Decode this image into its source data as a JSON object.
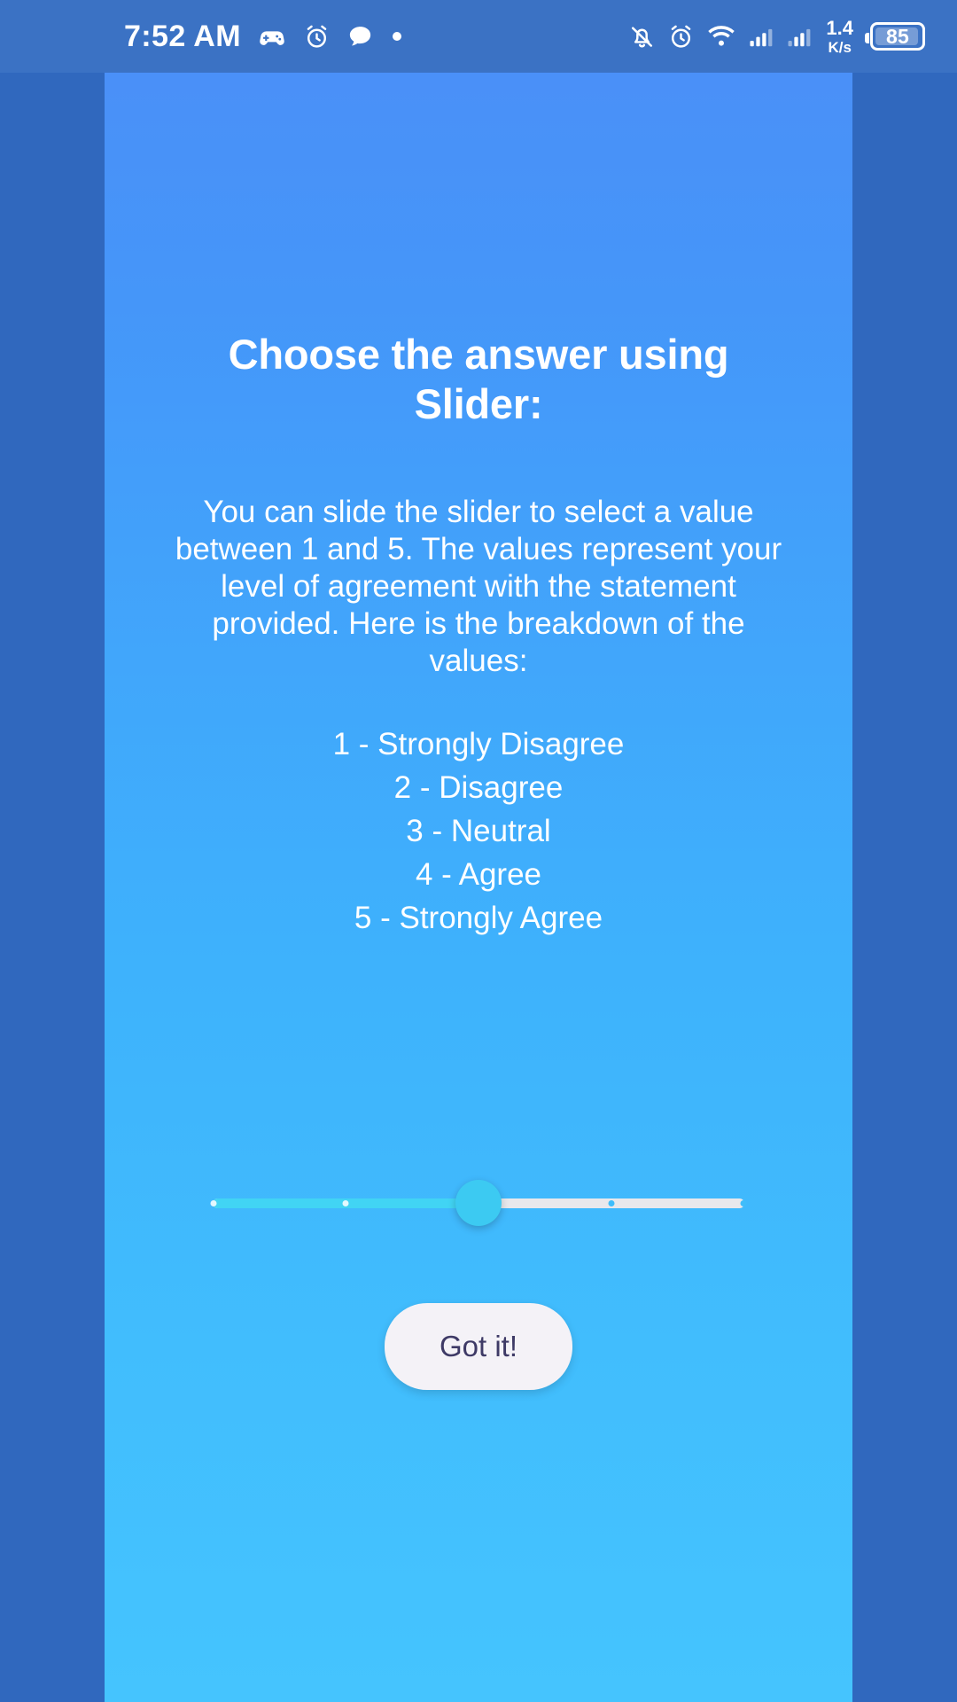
{
  "status_bar": {
    "clock": "7:52 AM",
    "left_icons": [
      "gamepad-icon",
      "alarm-clock-icon",
      "chat-bubble-icon",
      "dot-icon"
    ],
    "right_icons": [
      "bell-muted-icon",
      "alarm-clock-icon",
      "wifi-icon",
      "signal-bars-icon",
      "signal-bars-icon"
    ],
    "network_rate_value": "1.4",
    "network_rate_unit": "K/s",
    "battery_level": "85"
  },
  "dialog": {
    "title": "Choose the answer using Slider:",
    "description": "You can slide the slider to select a value between 1 and 5. The values represent your level of agreement with the statement provided. Here is the breakdown of the values:",
    "scale": [
      "1 - Strongly Disagree",
      "2 - Disagree",
      "3 - Neutral",
      "4 - Agree",
      "5 - Strongly Agree"
    ],
    "slider": {
      "min": "1",
      "max": "5",
      "value": "3",
      "active_color": "#41d4f4",
      "inactive_color": "#e8e8ec",
      "thumb_color": "#3ccaf2"
    },
    "confirm_label": "Got it!"
  },
  "theme": {
    "frame_color": "#3068be",
    "status_bar_color": "#3b72c4",
    "gradient_top": "#4a90f8",
    "gradient_bottom": "#45c4fe",
    "button_bg": "#f4f2f7",
    "button_text": "#3e3a66"
  }
}
